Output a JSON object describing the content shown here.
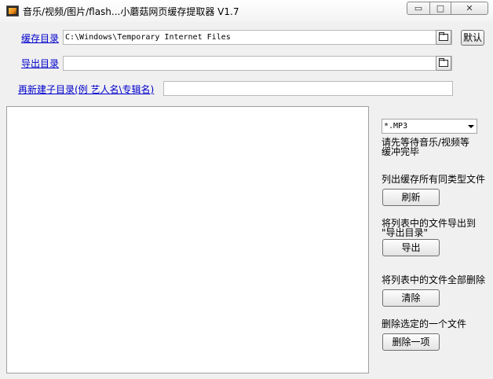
{
  "window": {
    "title": "音乐/视频/图片/flash...小蘑菇网页缓存提取器 V1.7",
    "min_glyph": "▭",
    "max_glyph": "□",
    "close_glyph": "✕"
  },
  "cache_dir": {
    "label": "缓存目录",
    "value": "C:\\Windows\\Temporary Internet Files"
  },
  "default_button": "默认",
  "export_dir": {
    "label": "导出目录",
    "value": ""
  },
  "subdir": {
    "label": "再新建子目录(例 艺人名\\专辑名)",
    "value": ""
  },
  "file_type": {
    "selected": "*.MP3"
  },
  "notes": {
    "wait_line1": "请先等待音乐/视频等",
    "wait_line2": "缓冲完毕"
  },
  "actions": {
    "refresh": {
      "desc": "列出缓存所有同类型文件",
      "button": "刷新"
    },
    "export": {
      "desc_line1": "将列表中的文件导出到",
      "desc_line2": "\"导出目录\"",
      "button": "导出"
    },
    "clear": {
      "desc": "将列表中的文件全部删除",
      "button": "清除"
    },
    "delete_one": {
      "desc": "删除选定的一个文件",
      "button": "删除一项"
    }
  }
}
